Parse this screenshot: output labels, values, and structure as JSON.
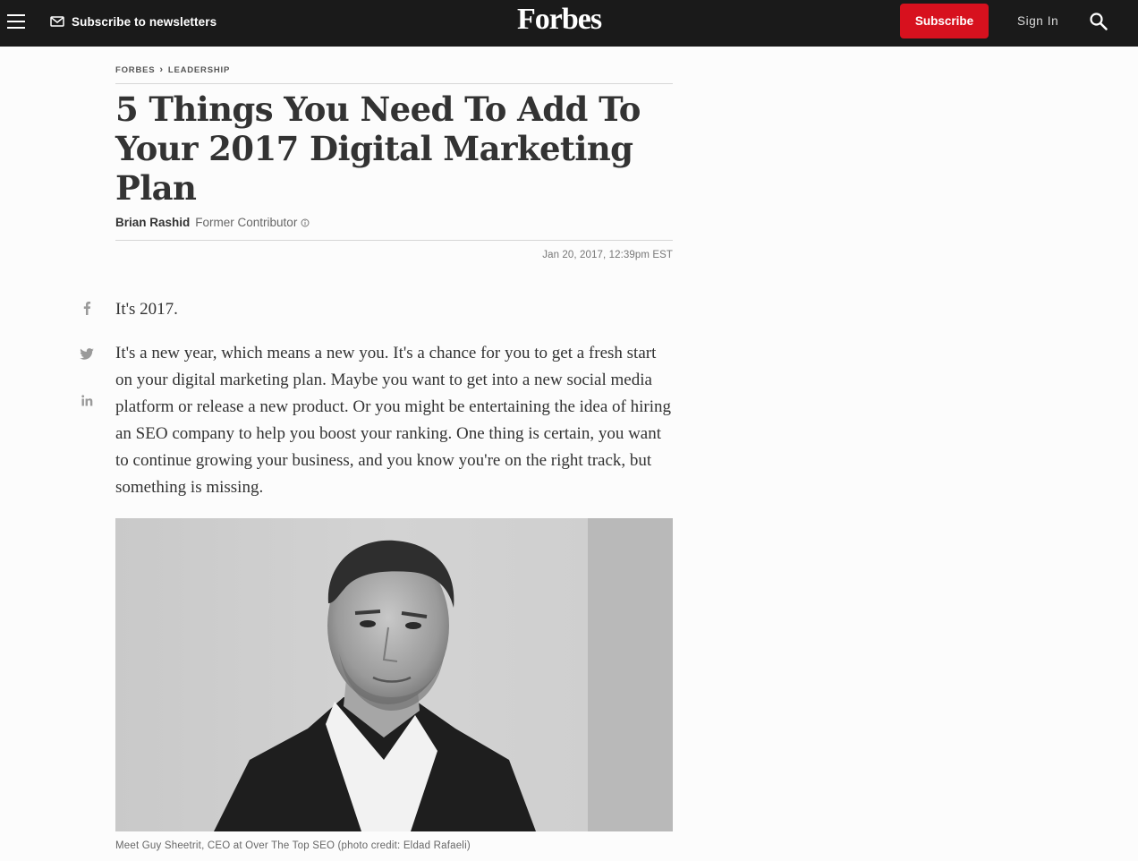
{
  "header": {
    "newsletter_label": "Subscribe to newsletters",
    "logo_text": "Forbes",
    "subscribe_label": "Subscribe",
    "signin_label": "Sign In",
    "accent_color": "#d7111e",
    "bg_color": "#1a1a1a"
  },
  "breadcrumb": {
    "items": [
      "FORBES",
      "LEADERSHIP"
    ]
  },
  "article": {
    "title": "5 Things You Need To Add To Your 2017 Digital Marketing Plan",
    "author": "Brian Rashid",
    "author_role": "Former Contributor",
    "date": "Jan 20, 2017, 12:39pm EST",
    "paragraphs": [
      "It's 2017.",
      "It's a new year, which means a new you. It's a chance for you to get a fresh start on your digital marketing plan. Maybe you want to get into a new social media platform or release a new product. Or you might be entertaining the idea of hiring an SEO company to help you boost your ranking. One thing is certain, you want to continue growing your business, and you know you're on the right track, but something is missing."
    ],
    "image_caption": "Meet Guy Sheetrit, CEO at Over The Top SEO (photo credit: Eldad Rafaeli)"
  },
  "share": {
    "icons": [
      "facebook-icon",
      "twitter-icon",
      "linkedin-icon"
    ]
  }
}
